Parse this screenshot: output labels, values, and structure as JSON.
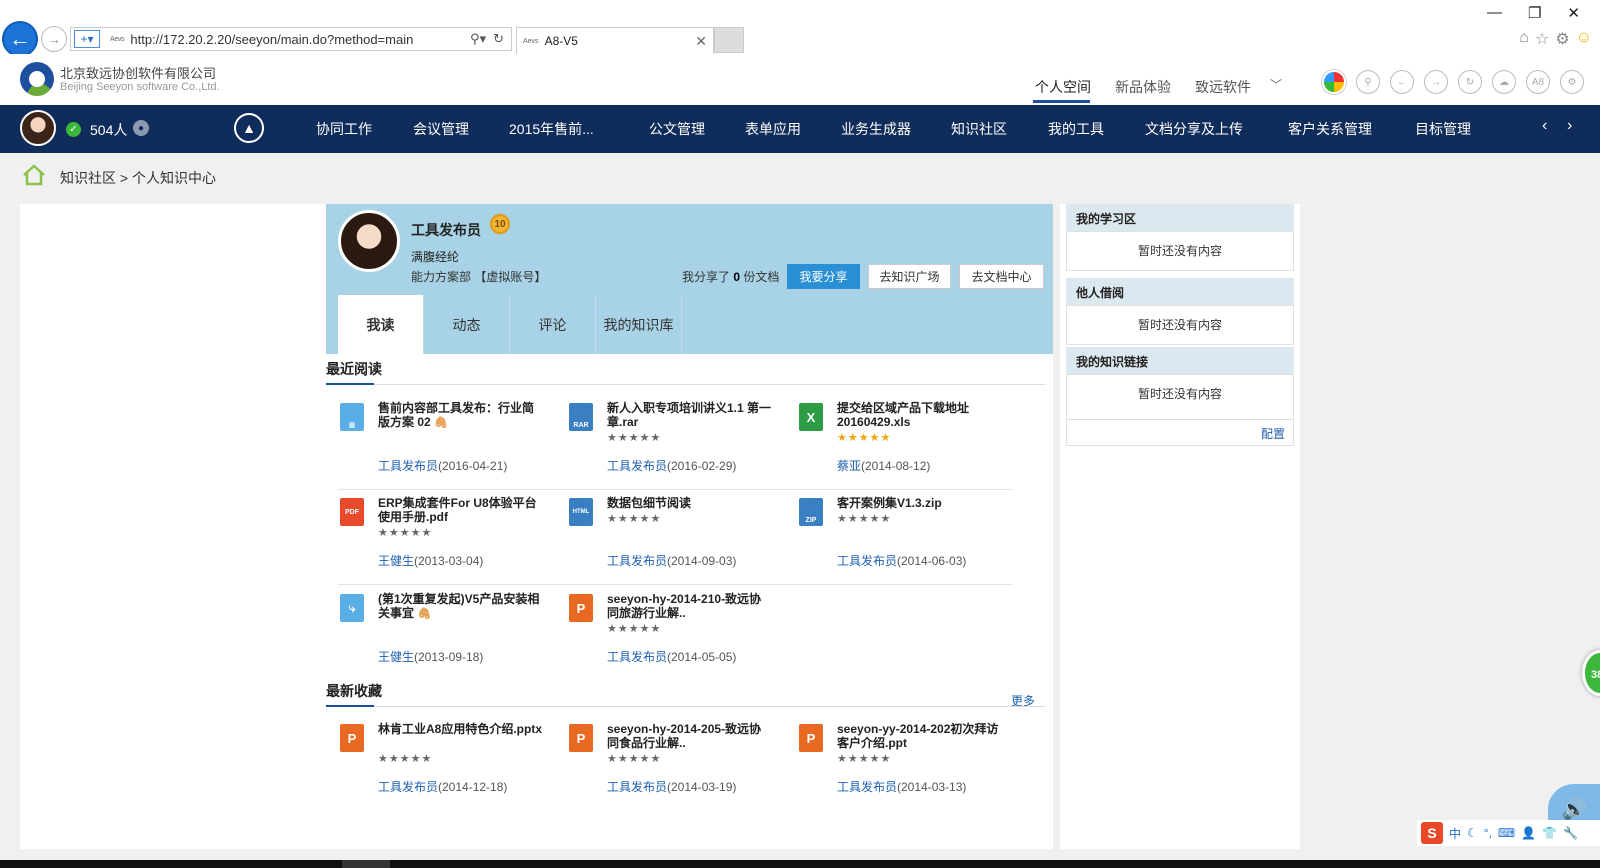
{
  "browser": {
    "url": "http://172.20.2.20/seeyon/main.do?method=main",
    "favicon_text": "Aevs",
    "tab_title": "A8-V5"
  },
  "header": {
    "company_cn": "北京致远协创软件有限公司",
    "company_en": "Beijing Seeyon software Co.,Ltd.",
    "links": [
      "个人空间",
      "新品体验",
      "致远软件"
    ],
    "circle_a8": "A8"
  },
  "nav": {
    "online_count": "504人",
    "items": [
      "协同工作",
      "会议管理",
      "2015年售前...",
      "公文管理",
      "表单应用",
      "业务生成器",
      "知识社区",
      "我的工具",
      "文档分享及上传",
      "客户关系管理",
      "目标管理"
    ]
  },
  "breadcrumb": {
    "root": "知识社区",
    "separator": ">",
    "current": "个人知识中心"
  },
  "profile": {
    "name": "工具发布员",
    "level": "10",
    "motto": "满腹经纶",
    "dept": "能力方案部 【虚拟账号】",
    "share_prefix": "我分享了",
    "share_count": "0",
    "share_suffix": "份文档",
    "btn_share": "我要分享",
    "btn_square": "去知识广场",
    "btn_doc": "去文档中心"
  },
  "tabs": [
    "我读",
    "动态",
    "评论",
    "我的知识库"
  ],
  "recent": {
    "title": "最近阅读",
    "items": [
      {
        "icon": "table-icon",
        "title": "售前内容部工具发布：行业简版方案 02",
        "attach": true,
        "stars": "★★★★★",
        "author": "工具发布员",
        "date": "(2016-04-21)"
      },
      {
        "icon": "rar-icon",
        "label": "RAR",
        "title": "新人入职专项培训讲义1.1 第一章.rar",
        "attach": false,
        "stars": "★★★★★",
        "author": "工具发布员",
        "date": "(2016-02-29)"
      },
      {
        "icon": "excel-icon",
        "label": "X",
        "title": "提交给区域产品下载地址20160429.xls",
        "attach": false,
        "stars": "★★★★★",
        "author": "蔡亚",
        "date": "(2014-08-12)"
      },
      {
        "icon": "pdf-icon",
        "label": "PDF",
        "title": "ERP集成套件For U8体验平台使用手册.pdf",
        "attach": false,
        "stars": "★★★★★",
        "author": "王健生",
        "date": "(2013-03-04)"
      },
      {
        "icon": "html-icon",
        "label": "HTML",
        "title": "数据包细节阅读",
        "attach": false,
        "stars": "★★★★★",
        "author": "工具发布员",
        "date": "(2014-09-03)"
      },
      {
        "icon": "zip-icon",
        "label": "ZIP",
        "title": "客开案例集V1.3.zip",
        "attach": false,
        "stars": "★★★★★",
        "author": "工具发布员",
        "date": "(2014-06-03)"
      },
      {
        "icon": "workflow-icon",
        "title": "(第1次重复发起)V5产品安装相关事宜",
        "attach": true,
        "stars": "",
        "author": "王健生",
        "date": "(2013-09-18)"
      },
      {
        "icon": "ppt-icon",
        "label": "P",
        "title": "seeyon-hy-2014-210-致远协同旅游行业解..",
        "attach": false,
        "stars": "★★★★★",
        "author": "工具发布员",
        "date": "(2014-05-05)"
      }
    ]
  },
  "favorites": {
    "title": "最新收藏",
    "more": "更多",
    "items": [
      {
        "icon": "ppt-icon",
        "label": "P",
        "title": "林肯工业A8应用特色介绍.pptx",
        "stars": "★★★★★",
        "author": "工具发布员",
        "date": "(2014-12-18)"
      },
      {
        "icon": "ppt-icon",
        "label": "P",
        "title": "seeyon-hy-2014-205-致远协同食品行业解..",
        "stars": "★★★★★",
        "author": "工具发布员",
        "date": "(2014-03-19)"
      },
      {
        "icon": "ppt-icon",
        "label": "P",
        "title": "seeyon-yy-2014-202初次拜访客户介绍.ppt",
        "stars": "★★★★★",
        "author": "工具发布员",
        "date": "(2014-03-13)"
      }
    ]
  },
  "right": {
    "study_title": "我的学习区",
    "study_empty": "暂时还没有内容",
    "borrow_title": "他人借阅",
    "borrow_empty": "暂时还没有内容",
    "links_title": "我的知识链接",
    "links_empty": "暂时还没有内容",
    "config": "配置"
  },
  "widgets": {
    "bubble": "38",
    "ime_logo": "S",
    "ime_lang": "中"
  },
  "colors": {
    "navbar": "#0f2c5a",
    "accent": "#1d4f9f",
    "profile_bg": "#a8d3e6",
    "button": "#2b8fd6",
    "link": "#1d5fb0"
  }
}
